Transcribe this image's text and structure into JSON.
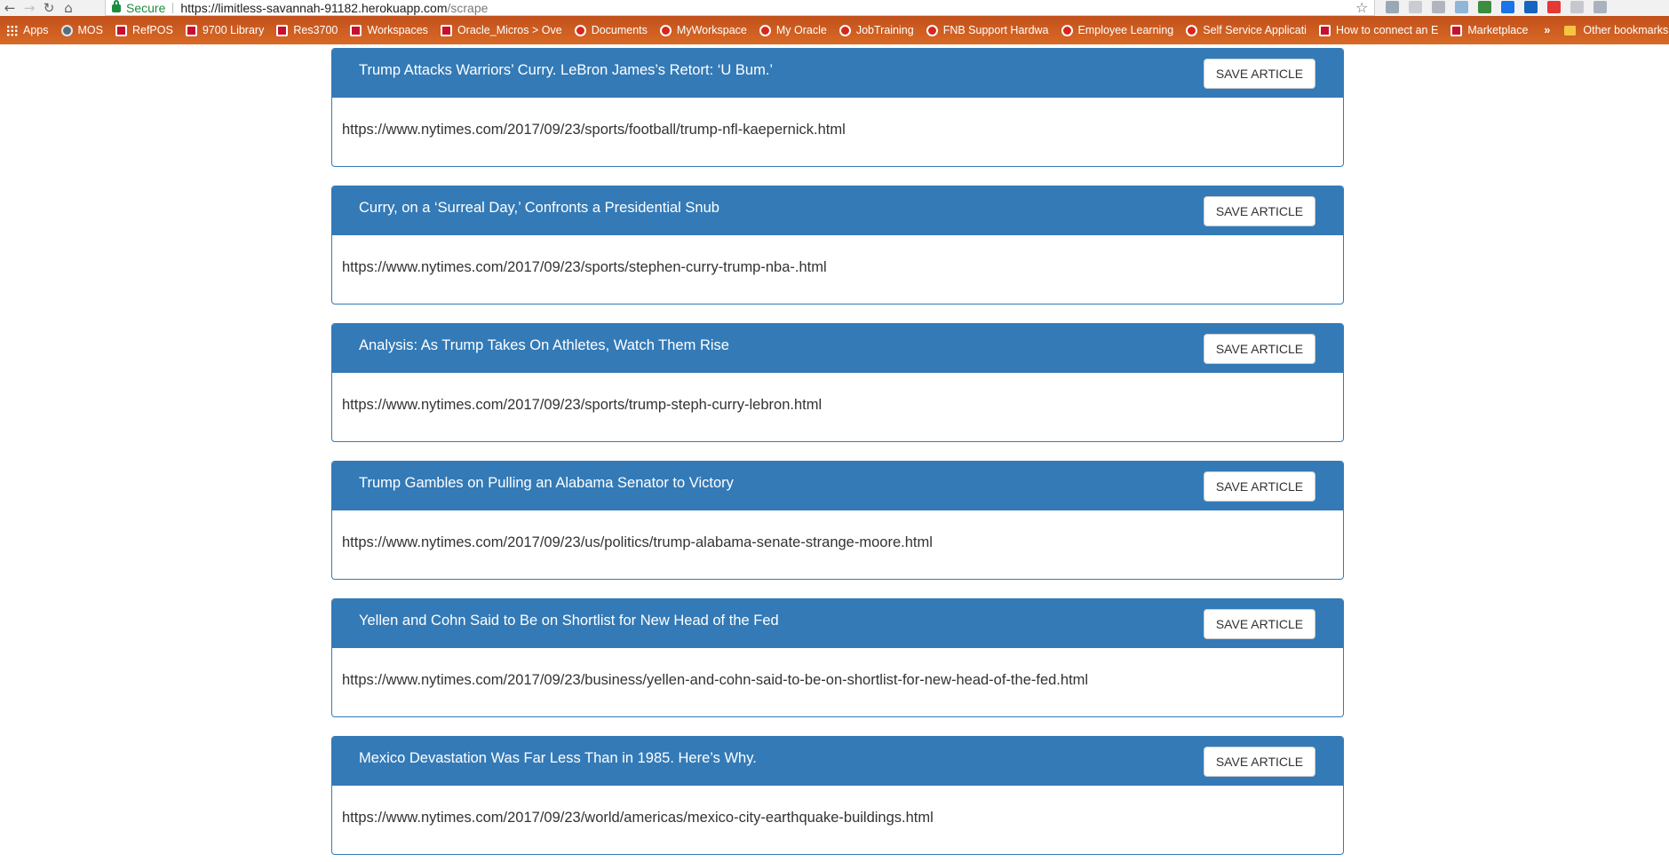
{
  "browser": {
    "secure_label": "Secure",
    "url_host": "https://limitless-savannah-91182.herokuapp.com",
    "url_path": "/scrape",
    "bookmarks": [
      {
        "label": "Apps",
        "icon": "apps-grid-icon"
      },
      {
        "label": "MOS",
        "icon": "globe-icon"
      },
      {
        "label": "RefPOS",
        "icon": "oracle-icon"
      },
      {
        "label": "9700 Library",
        "icon": "oracle-icon"
      },
      {
        "label": "Res3700",
        "icon": "oracle-icon"
      },
      {
        "label": "Workspaces",
        "icon": "oracle-icon"
      },
      {
        "label": "Oracle_Micros > Ove",
        "icon": "oracle-icon"
      },
      {
        "label": "Documents",
        "icon": "oracle-icon"
      },
      {
        "label": "MyWorkspace",
        "icon": "oracle-icon"
      },
      {
        "label": "My Oracle",
        "icon": "oracle-icon"
      },
      {
        "label": "JobTraining",
        "icon": "oracle-icon"
      },
      {
        "label": "FNB Support Hardwa",
        "icon": "oracle-icon"
      },
      {
        "label": "Employee Learning",
        "icon": "oracle-icon"
      },
      {
        "label": "Self Service Applicati",
        "icon": "oracle-icon"
      },
      {
        "label": "How to connect an E",
        "icon": "magento-icon"
      },
      {
        "label": "Marketplace",
        "icon": "magento-icon"
      }
    ],
    "more_bookmarks": "»",
    "other_bookmarks": "Other bookmarks"
  },
  "articles": [
    {
      "title": "Trump Attacks Warriors’ Curry. LeBron James’s Retort: ‘U Bum.’",
      "link": "https://www.nytimes.com/2017/09/23/sports/football/trump-nfl-kaepernick.html",
      "save_label": "SAVE ARTICLE"
    },
    {
      "title": "Curry, on a ‘Surreal Day,’ Confronts a Presidential Snub",
      "link": "https://www.nytimes.com/2017/09/23/sports/stephen-curry-trump-nba-.html",
      "save_label": "SAVE ARTICLE"
    },
    {
      "title": "Analysis: As Trump Takes On Athletes, Watch Them Rise",
      "link": "https://www.nytimes.com/2017/09/23/sports/trump-steph-curry-lebron.html",
      "save_label": "SAVE ARTICLE"
    },
    {
      "title": "Trump Gambles on Pulling an Alabama Senator to Victory",
      "link": "https://www.nytimes.com/2017/09/23/us/politics/trump-alabama-senate-strange-moore.html",
      "save_label": "SAVE ARTICLE"
    },
    {
      "title": "Yellen and Cohn Said to Be on Shortlist for New Head of the Fed",
      "link": "https://www.nytimes.com/2017/09/23/business/yellen-and-cohn-said-to-be-on-shortlist-for-new-head-of-the-fed.html",
      "save_label": "SAVE ARTICLE"
    },
    {
      "title": "Mexico Devastation Was Far Less Than in 1985. Here’s Why.",
      "link": "https://www.nytimes.com/2017/09/23/world/americas/mexico-city-earthquake-buildings.html",
      "save_label": "SAVE ARTICLE"
    }
  ]
}
